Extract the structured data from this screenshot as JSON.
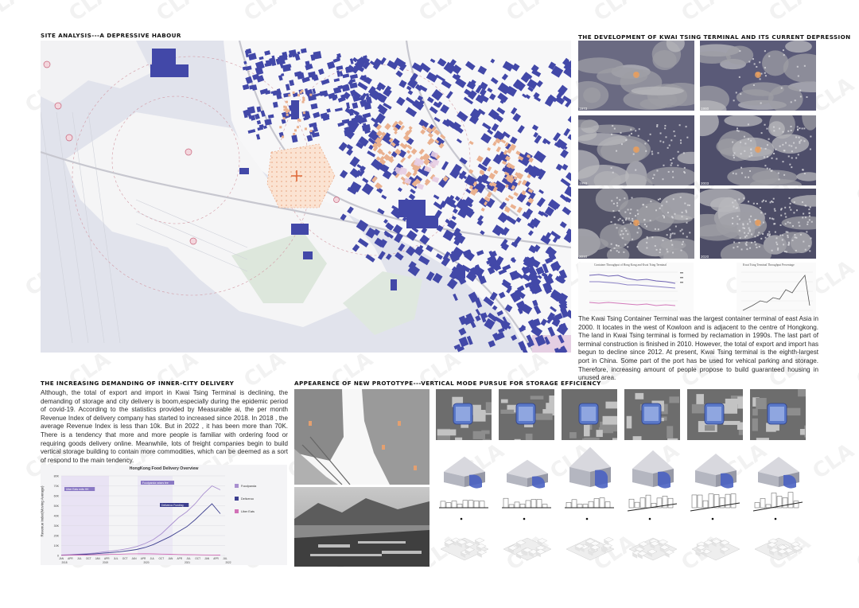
{
  "site_analysis": {
    "heading": "SITE ANALYSIS---A DEPRESSIVE HABOUR"
  },
  "development": {
    "heading": "THE DEVELOPMENT OF KWAI TSING TERMINAL AND ITS CURRENT DEPRESSION",
    "years": [
      "1973",
      "1980",
      "1993",
      "2003",
      "2010",
      "2020"
    ],
    "chart_titles": [
      "Container Throughput of Hong Kong and Kwai Tsing Terminal",
      "Kwai Tsing Terminal Throughput Percentage"
    ],
    "paragraph": "The Kwai Tsing Container Terminal was the largest container terminal of east Asia in 2000. It locates in the west of Kowloon and is adjacent to the centre of Hongkong. The land in Kwai Tsing terminal is formed by reclamation in 1990s. The last part of terminal construction is finished in 2010. However, the total of export and import has begun to decline since 2012. At present, Kwai Tsing terminal is the eighth-largest port in China. Some part of the port has be used for vehical parking and storage. Therefore, increasing amount of people propose to build guaranteed housing in  unused area."
  },
  "delivery": {
    "heading": "THE INCREASING DEMANDING OF INNER-CITY DELIVERY",
    "paragraph": "Although, the total of export and import in Kwai Tsing Terminal is declining, the demanding of storage and city delivery is boom,especially during the epidemic period of covid-19. According to the statistics provided by Measurable ai, the per month Revenue Index of delivery company has started to increased since 2018. In 2018 , the average Revenue Index is less than 10k. But in 2022 , it has been more than 70K. There is a tendency that more and more people is familiar with ordering food or requiring goods delivery online. Meanwhile, lots of freight companies begin to build vertical storage building to contain more commodities, which can be deemed as a sort of respond to the main tendency."
  },
  "prototype": {
    "heading": "APPEARENCE OF NEW PROTOTYPE---VERTICAL MODE PURSUE FOR STORAGE EFFICIENCY"
  },
  "chart_data": [
    {
      "type": "line",
      "title": "HongKong Food Delivery Overview",
      "ylabel": "Revenue Index(Moving Average)",
      "y_ticks": [
        "80K",
        "70K",
        "60K",
        "50K",
        "40K",
        "30K",
        "20K",
        "10K",
        "0"
      ],
      "ylim": [
        0,
        80000
      ],
      "x_ticks": [
        "JAN",
        "APR",
        "JUL",
        "OCT",
        "JAN",
        "APR",
        "JUL",
        "OCT",
        "JAN",
        "APR",
        "JUL",
        "OCT",
        "JAN",
        "APR",
        "JUL",
        "OCT",
        "JAN",
        "APR",
        "JUL"
      ],
      "x_years": [
        "2018",
        "2019",
        "2020",
        "2021",
        "2022"
      ],
      "series": [
        {
          "name": "Foodpanda",
          "color": "#a98fcf",
          "values": [
            500,
            800,
            1200,
            1800,
            2500,
            3500,
            4500,
            5500,
            7000,
            9000,
            12000,
            16000,
            22000,
            30000,
            38000,
            44000,
            52000,
            62000,
            70000,
            66000
          ]
        },
        {
          "name": "Deliveroo",
          "color": "#3d3f8f",
          "values": [
            300,
            500,
            800,
            1200,
            1700,
            2300,
            3000,
            3800,
            4800,
            6000,
            8000,
            11000,
            15000,
            19000,
            24000,
            29000,
            36000,
            44000,
            52000,
            42000
          ]
        },
        {
          "name": "Uber Eats",
          "color": "#d271b7",
          "values": [
            200,
            300,
            400,
            500,
            700,
            900,
            1100,
            1300,
            1500,
            1700,
            1800,
            1600,
            1400,
            1200,
            1000,
            800,
            700,
            600,
            500,
            400
          ]
        }
      ],
      "annotations": [
        "Uber Eats exits HK",
        "Foodpanda raises fee",
        "Deliveroo Funding"
      ]
    }
  ],
  "watermark": "CLA"
}
